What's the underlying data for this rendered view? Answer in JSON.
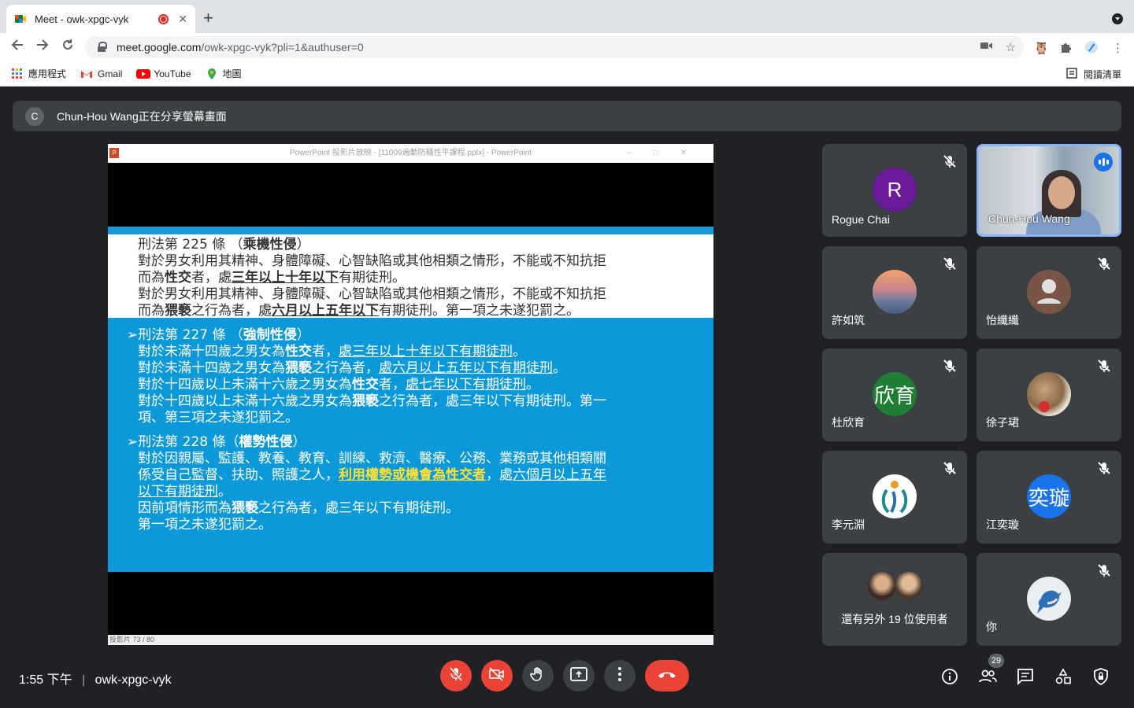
{
  "browser": {
    "tab_title": "Meet - owk-xpgc-vyk",
    "tab_close": "✕",
    "new_tab": "+",
    "url_host": "meet.google.com",
    "url_path": "/owk-xpgc-vyk?pli=1&authuser=0",
    "bookmarks": [
      {
        "label": "應用程式",
        "icon": "apps-grid-icon"
      },
      {
        "label": "Gmail",
        "icon": "gmail-icon"
      },
      {
        "label": "YouTube",
        "icon": "youtube-icon"
      },
      {
        "label": "地圖",
        "icon": "maps-icon"
      }
    ],
    "reading_list": "閱讀清單"
  },
  "banner": {
    "avatar_letter": "C",
    "text": "Chun-Hou Wang正在分享螢幕畫面"
  },
  "presentation": {
    "window_title": "PowerPoint 投影片放映 - [11009遍動防騷性平課程.pptx] - PowerPoint",
    "status": "投影片 73 / 80",
    "white_lines": [
      "刑法第 225 條 （乘機性侵）",
      "對於男女利用其精神、身體障礙、心智缺陷或其他相類之情形，不能或不知抗拒",
      "而為性交者，處三年以上十年以下有期徒刑。",
      "對於男女利用其精神、身體障礙、心智缺陷或其他相類之情形，不能或不知抗拒",
      "而為猥褻之行為者，處六月以上五年以下有期徒刑。第一項之未遂犯罰之。"
    ],
    "s227_head": "➢刑法第 227 條 （強制性侵）",
    "s227_lines": [
      "對於未滿十四歲之男女為性交者，處三年以上十年以下有期徒刑。",
      "對於未滿十四歲之男女為猥褻之行為者，處六月以上五年以下有期徒刑。",
      "對於十四歲以上未滿十六歲之男女為性交者，處七年以下有期徒刑。",
      "對於十四歲以上未滿十六歲之男女為猥褻之行為者，處三年以下有期徒刑。第一",
      "項、第三項之未遂犯罰之。"
    ],
    "s228_head": "➢刑法第 228 條（權勢性侵）",
    "s228_lines": [
      "對於因親屬、監護、教養、教育、訓練、救濟、醫療、公務、業務或其他相類關",
      "係受自己監督、扶助、照護之人，利用權勢或機會為性交者，處六個月以上五年",
      "以下有期徒刑。",
      "因前項情形而為猥褻之行為者，處三年以下有期徒刑。",
      "第一項之未遂犯罰之。"
    ]
  },
  "participants": [
    {
      "name": "Rogue Chai",
      "avatar": "R",
      "color": "#6a1b9a",
      "muted": true
    },
    {
      "name": "Chun-Hou Wang",
      "video": true,
      "speaking": true
    },
    {
      "name": "許如筑",
      "avatar_type": "photo-sunset",
      "muted": true
    },
    {
      "name": "怡纖纖",
      "avatar_type": "default-person",
      "color": "#795548",
      "muted": true
    },
    {
      "name": "杜欣育",
      "avatar": "欣育",
      "color": "#1e7e34",
      "muted": true
    },
    {
      "name": "徐子珺",
      "avatar_type": "photo-food",
      "muted": true
    },
    {
      "name": "李元淵",
      "avatar_type": "photo-logo",
      "muted": true
    },
    {
      "name": "江奕璇",
      "avatar": "奕璇",
      "color": "#1a73e8",
      "muted": true
    },
    {
      "name": "還有另外 19 位使用者",
      "avatar_type": "group"
    },
    {
      "name": "你",
      "avatar_type": "photo-bird",
      "muted": true
    }
  ],
  "bottom": {
    "time": "1:55 下午",
    "separator": "|",
    "meeting_code": "owk-xpgc-vyk",
    "people_count": "29"
  }
}
